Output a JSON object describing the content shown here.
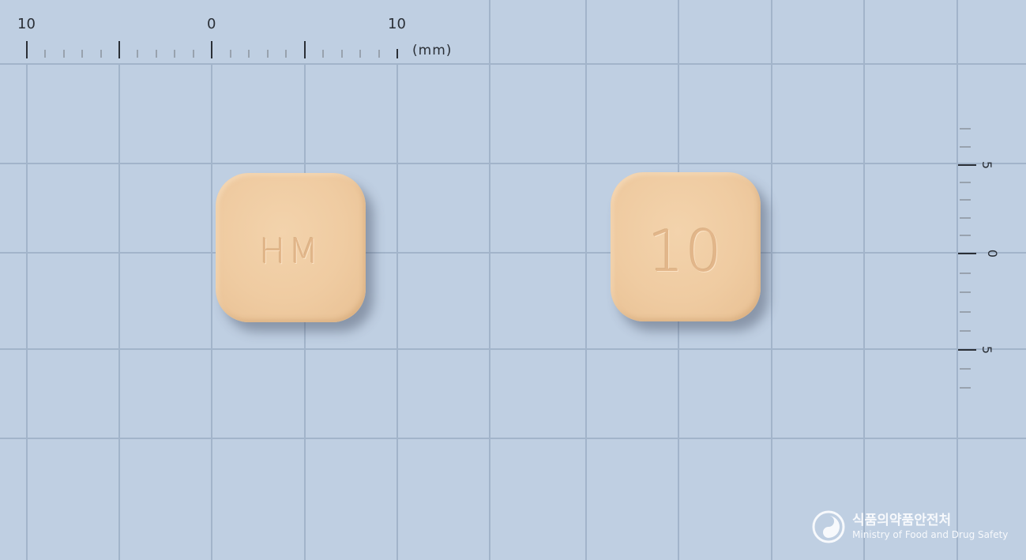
{
  "ruler_top": {
    "labels": [
      "10",
      "0",
      "10"
    ],
    "unit": "(mm)"
  },
  "ruler_right": {
    "labels": [
      "5",
      "0",
      "5"
    ]
  },
  "pills": [
    {
      "imprint": "HM",
      "color": "#efcba1"
    },
    {
      "imprint": "10",
      "color": "#efcba1"
    }
  ],
  "logo": {
    "name_korean": "식품의약품안전처",
    "name_english": "Ministry of Food and Drug Safety"
  },
  "colors": {
    "background": "#bfcfe2",
    "grid_line": "#9fb1c7"
  }
}
